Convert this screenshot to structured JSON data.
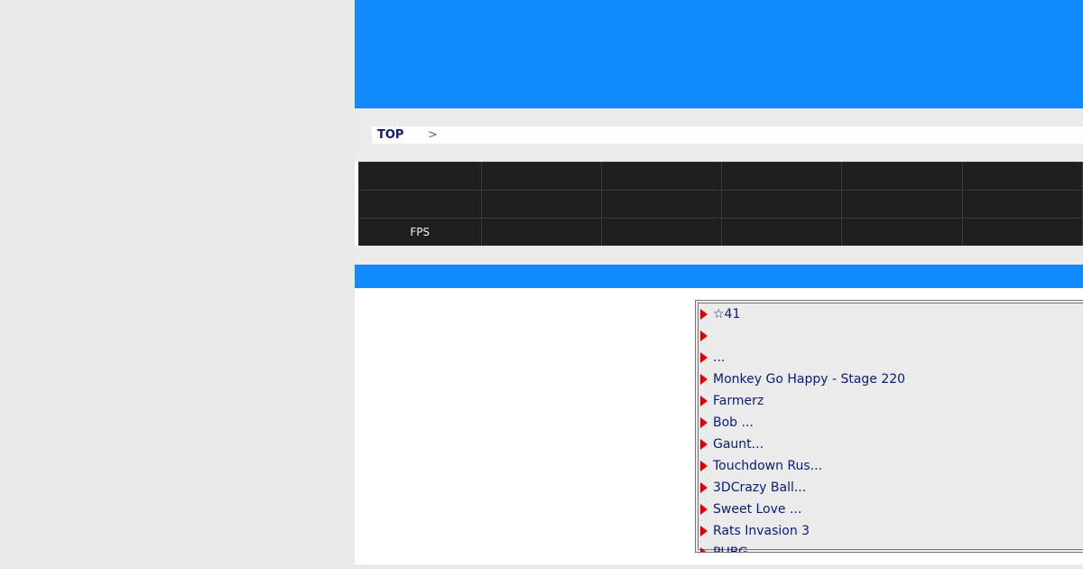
{
  "theme": {
    "accent": "#1289ff",
    "list_arrow": "#e00000",
    "link_color": "#0a1a7a"
  },
  "breadcrumb": {
    "top_label": "TOP",
    "separator": ">"
  },
  "spec_table": {
    "rows": [
      [
        "",
        "",
        "",
        "",
        "",
        ""
      ],
      [
        "",
        "",
        "",
        "",
        "",
        ""
      ],
      [
        "FPS",
        "",
        "",
        "",
        "",
        ""
      ]
    ]
  },
  "game_list": {
    "items": [
      {
        "label": "☆41"
      },
      {
        "label": ""
      },
      {
        "label": " ..."
      },
      {
        "label": "Monkey Go Happy - Stage 220"
      },
      {
        "label": "Farmerz"
      },
      {
        "label": "Bob ..."
      },
      {
        "label": "Gaunt..."
      },
      {
        "label": "Touchdown Rus..."
      },
      {
        "label": "3DCrazy Ball..."
      },
      {
        "label": "Sweet Love ..."
      },
      {
        "label": "Rats Invasion 3"
      },
      {
        "label": "PUBG"
      }
    ]
  }
}
